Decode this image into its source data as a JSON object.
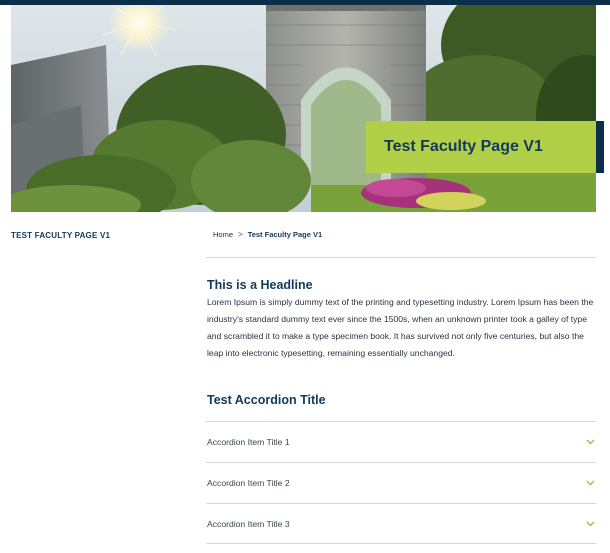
{
  "colors": {
    "navy": "#0b2f4a",
    "accent_green": "#b2cf48",
    "title_text": "#123a5c"
  },
  "hero": {
    "title": "Test Faculty Page V1",
    "image_icon": "stone-archway-photo"
  },
  "sidebar": {
    "title": "TEST FACULTY PAGE V1"
  },
  "breadcrumb": {
    "home": "Home",
    "separator": ">",
    "current": "Test Faculty Page V1"
  },
  "content": {
    "headline": "This is a Headline",
    "body": "Lorem Ipsum is simply dummy text of the printing and typesetting industry. Lorem Ipsum has been the industry's standard dummy text ever since the 1500s, when an unknown printer took a galley of type and scrambled it to make a type specimen book. It has survived not only five centuries, but also the leap into electronic typesetting, remaining essentially unchanged."
  },
  "accordion": {
    "title": "Test Accordion Title",
    "items": [
      {
        "label": "Accordion Item Title 1",
        "icon": "chevron-down-icon"
      },
      {
        "label": "Accordion Item Title 2",
        "icon": "chevron-down-icon"
      },
      {
        "label": "Accordion Item Title 3",
        "icon": "chevron-down-icon"
      }
    ]
  }
}
